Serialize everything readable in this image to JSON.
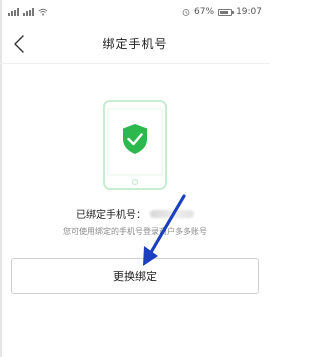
{
  "status_bar": {
    "battery_percent": "67%",
    "time": "19:07"
  },
  "header": {
    "title": "绑定手机号"
  },
  "content": {
    "bound_label": "已绑定手机号：",
    "hint": "您可使用绑定的手机号登录商户多多账号"
  },
  "actions": {
    "change_button_label": "更换绑定"
  },
  "colors": {
    "shield_green": "#2db84d",
    "phone_outline": "#c8ecd0",
    "arrow_blue": "#1a3fbf"
  }
}
